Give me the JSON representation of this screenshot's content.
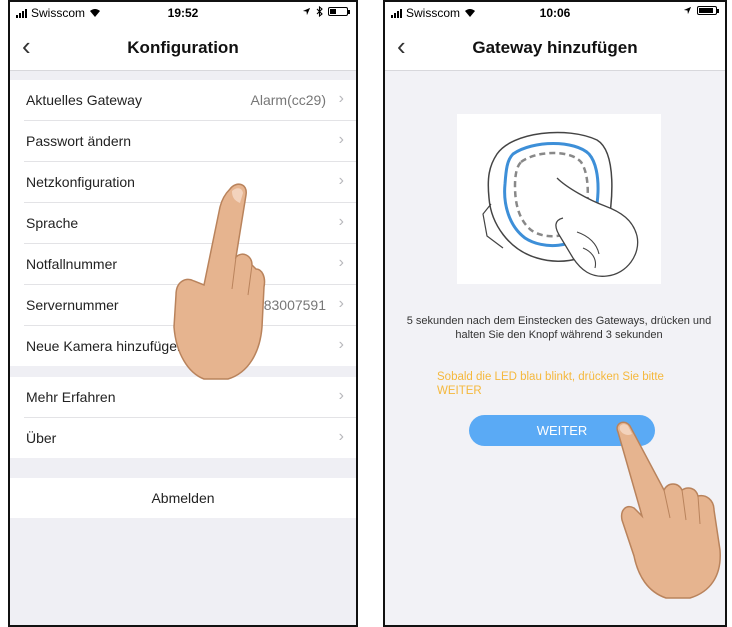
{
  "left_screen": {
    "status": {
      "carrier": "Swisscom",
      "time": "19:52"
    },
    "nav": {
      "back": "‹",
      "title": "Konfiguration"
    },
    "group1": [
      {
        "label": "Aktuelles Gateway",
        "value": "Alarm(cc29)"
      },
      {
        "label": "Passwort ändern",
        "value": ""
      },
      {
        "label": "Netzkonfiguration",
        "value": ""
      },
      {
        "label": "Sprache",
        "value": ""
      },
      {
        "label": "Notfallnummer",
        "value": ""
      },
      {
        "label": "Servernummer",
        "value": "-83007591"
      },
      {
        "label": "Neue Kamera hinzufügen",
        "value": ""
      }
    ],
    "group2": [
      {
        "label": "Mehr Erfahren"
      },
      {
        "label": "Über"
      }
    ],
    "logout": "Abmelden",
    "chevron": "›"
  },
  "right_screen": {
    "status": {
      "carrier": "Swisscom",
      "time": "10:06"
    },
    "nav": {
      "back": "‹",
      "title": "Gateway hinzufügen"
    },
    "instruction": "5 sekunden nach dem Einstecken des Gateways, drücken und halten Sie den Knopf während 3 sekunden",
    "hint": "Sobald die LED blau blinkt,  drücken Sie bitte WEITER",
    "button": "WEITER"
  },
  "colors": {
    "button_blue": "#5aaaf5",
    "hint_orange": "#f5b83c",
    "led_blue": "#3d8fd8"
  }
}
